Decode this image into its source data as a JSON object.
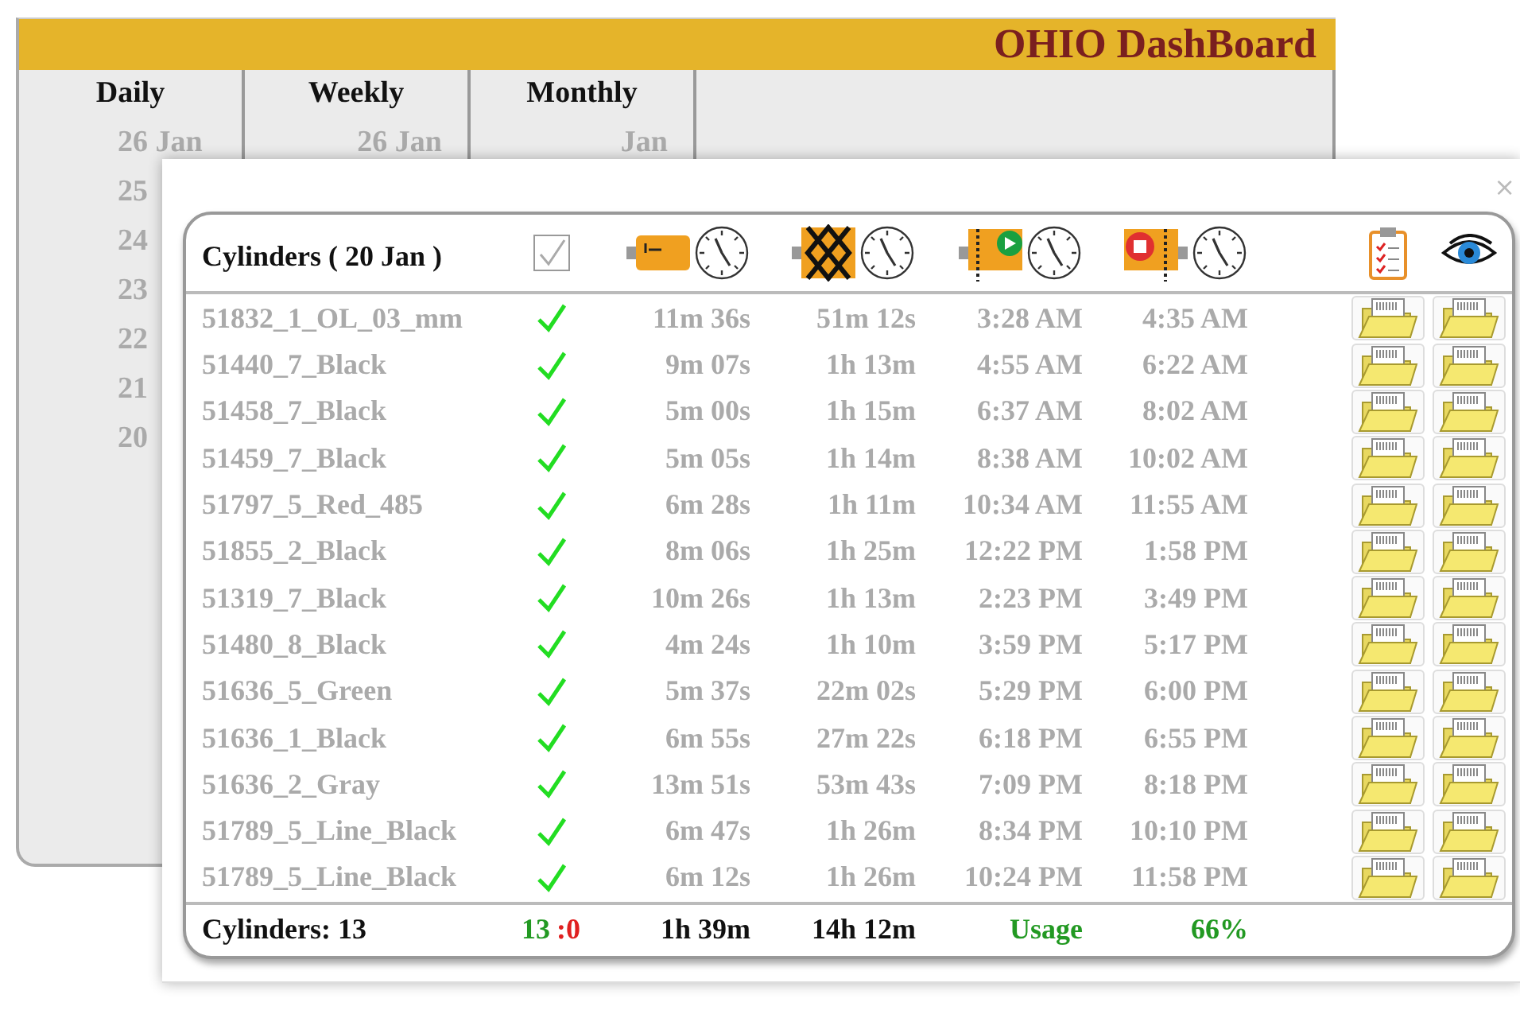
{
  "header": {
    "title": "OHIO DashBoard"
  },
  "periods": [
    {
      "label": "Daily",
      "dates": [
        "26 Jan",
        "25",
        "24",
        "23",
        "22",
        "21",
        "20"
      ]
    },
    {
      "label": "Weekly",
      "dates": [
        "26 Jan"
      ]
    },
    {
      "label": "Monthly",
      "dates": [
        "Jan"
      ]
    }
  ],
  "dialog": {
    "close": "×",
    "title": "Cylinders ( 20 Jan )",
    "all_checked": true,
    "rows": [
      {
        "name": "51832_1_OL_03_mm",
        "done": true,
        "column_3": "11m 36s",
        "column_4": "51m 12s",
        "column_5": "3:28 AM",
        "column_6": "4:35 AM"
      },
      {
        "name": "51440_7_Black",
        "done": true,
        "column_3": "9m 07s",
        "column_4": "1h 13m",
        "column_5": "4:55 AM",
        "column_6": "6:22 AM"
      },
      {
        "name": "51458_7_Black",
        "done": true,
        "column_3": "5m 00s",
        "column_4": "1h 15m",
        "column_5": "6:37 AM",
        "column_6": "8:02 AM"
      },
      {
        "name": "51459_7_Black",
        "done": true,
        "column_3": "5m 05s",
        "column_4": "1h 14m",
        "column_5": "8:38 AM",
        "column_6": "10:02 AM"
      },
      {
        "name": "51797_5_Red_485",
        "done": true,
        "column_3": "6m 28s",
        "column_4": "1h 11m",
        "column_5": "10:34 AM",
        "column_6": "11:55 AM"
      },
      {
        "name": "51855_2_Black",
        "done": true,
        "column_3": "8m 06s",
        "column_4": "1h 25m",
        "column_5": "12:22 PM",
        "column_6": "1:58 PM"
      },
      {
        "name": "51319_7_Black",
        "done": true,
        "column_3": "10m 26s",
        "column_4": "1h 13m",
        "column_5": "2:23 PM",
        "column_6": "3:49 PM"
      },
      {
        "name": "51480_8_Black",
        "done": true,
        "column_3": "4m 24s",
        "column_4": "1h 10m",
        "column_5": "3:59 PM",
        "column_6": "5:17 PM"
      },
      {
        "name": "51636_5_Green",
        "done": true,
        "column_3": "5m 37s",
        "column_4": "22m 02s",
        "column_5": "5:29 PM",
        "column_6": "6:00 PM"
      },
      {
        "name": "51636_1_Black",
        "done": true,
        "column_3": "6m 55s",
        "column_4": "27m 22s",
        "column_5": "6:18 PM",
        "column_6": "6:55 PM"
      },
      {
        "name": "51636_2_Gray",
        "done": true,
        "column_3": "13m 51s",
        "column_4": "53m 43s",
        "column_5": "7:09 PM",
        "column_6": "8:18 PM"
      },
      {
        "name": "51789_5_Line_Black",
        "done": true,
        "column_3": "6m 47s",
        "column_4": "1h 26m",
        "column_5": "8:34 PM",
        "column_6": "10:10 PM"
      },
      {
        "name": "51789_5_Line_Black",
        "done": true,
        "column_3": "6m 12s",
        "column_4": "1h 26m",
        "column_5": "10:24 PM",
        "column_6": "11:58 PM"
      }
    ],
    "footer": {
      "count": "Cylinders: 13",
      "ok": "13",
      "failed": ":0",
      "column_3": "1h 39m",
      "column_4": "14h 12m",
      "usage_label": "Usage",
      "usage": "66%"
    }
  }
}
